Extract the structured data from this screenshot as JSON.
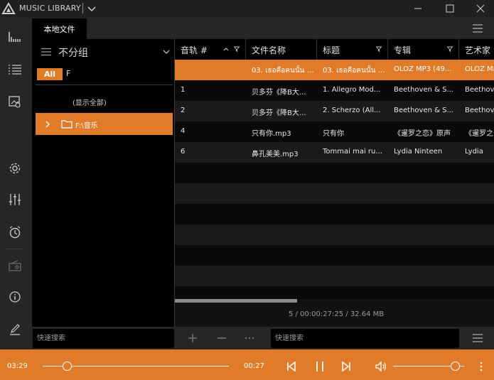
{
  "app": {
    "title": "MUSIC LIBRARY",
    "accent_color": "#e07c29"
  },
  "window_controls": {
    "icons": [
      "minimize-icon",
      "maximize-icon",
      "close-icon"
    ]
  },
  "rail": {
    "icons": [
      "library-bars-icon",
      "playlist-icon",
      "picture-gallery-icon",
      "settings-gear-icon",
      "equalizer-icon",
      "alarm-clock-icon",
      "radio-icon",
      "info-icon",
      "edit-icon"
    ]
  },
  "tabs": {
    "local_files": "本地文件"
  },
  "navigator": {
    "group_label": "不分组",
    "all_label": "All",
    "letters": [
      "F"
    ],
    "show_all": "(显示全部)",
    "folders": [
      {
        "label": "F:\\音乐",
        "selected": true
      }
    ]
  },
  "grid": {
    "columns": [
      {
        "label": "音轨 #",
        "sorted": "asc"
      },
      {
        "label": "文件名称"
      },
      {
        "label": "标题"
      },
      {
        "label": "专辑"
      },
      {
        "label": "艺术家"
      }
    ],
    "rows": [
      {
        "track": "",
        "filename": "03. เธอคือคนนั้น - ...",
        "title": "03. เธอคือคนนั้น - ...",
        "album": "OLOZ MP3 (49...",
        "artist": "OLOZ MP",
        "selected": true
      },
      {
        "track": "1",
        "filename": "贝多芬《降B大...",
        "title": "1. Allegro Mod...",
        "album": "Beethoven & S...",
        "artist": "Beethov"
      },
      {
        "track": "2",
        "filename": "贝多芬《降B大...",
        "title": "2. Scherzo (All...",
        "album": "Beethoven & S...",
        "artist": "Beethov"
      },
      {
        "track": "4",
        "filename": "只有你.mp3",
        "title": "只有你",
        "album": "《暹罗之恋》原声",
        "artist": "《暹罗之"
      },
      {
        "track": "6",
        "filename": "鼻孔美美.mp3",
        "title": "Tommai mai ru...",
        "album": "Lydia Ninteen",
        "artist": "Lydia"
      }
    ],
    "status": "5 / 00:00:27:25 / 32.64 MB"
  },
  "search": {
    "left_placeholder": "快速搜索",
    "right_placeholder": "快速搜索"
  },
  "list_tools": {
    "icons": [
      "add-icon",
      "remove-icon",
      "more-icon"
    ]
  },
  "player": {
    "elapsed": "03:29",
    "remaining": "00:27",
    "progress_fraction": 0.13,
    "volume_fraction": 0.87,
    "icons": [
      "previous-icon",
      "pause-icon",
      "next-icon",
      "volume-icon",
      "more-vertical-icon"
    ]
  }
}
